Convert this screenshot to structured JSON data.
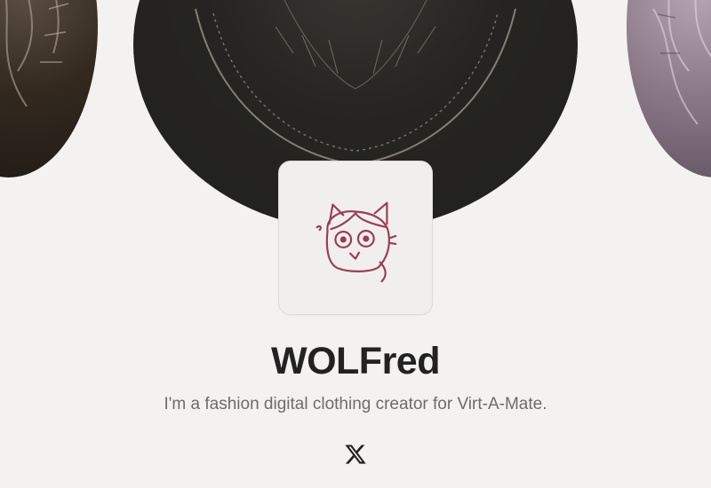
{
  "profile": {
    "name": "WOLFred",
    "bio": "I'm a fashion digital clothing creator for Virt-A-Mate."
  },
  "social_links": [
    {
      "icon": "x-logo-icon",
      "platform": "X"
    }
  ],
  "cover": {
    "panels": [
      "fabric-swatch-dark-brown",
      "embroidered-garment-black",
      "fabric-swatch-mauve"
    ]
  },
  "colors": {
    "page_background": "#f3f2f1",
    "name_text": "#222222",
    "bio_text": "#6e6c69",
    "avatar_stroke": "#9a3d52"
  }
}
